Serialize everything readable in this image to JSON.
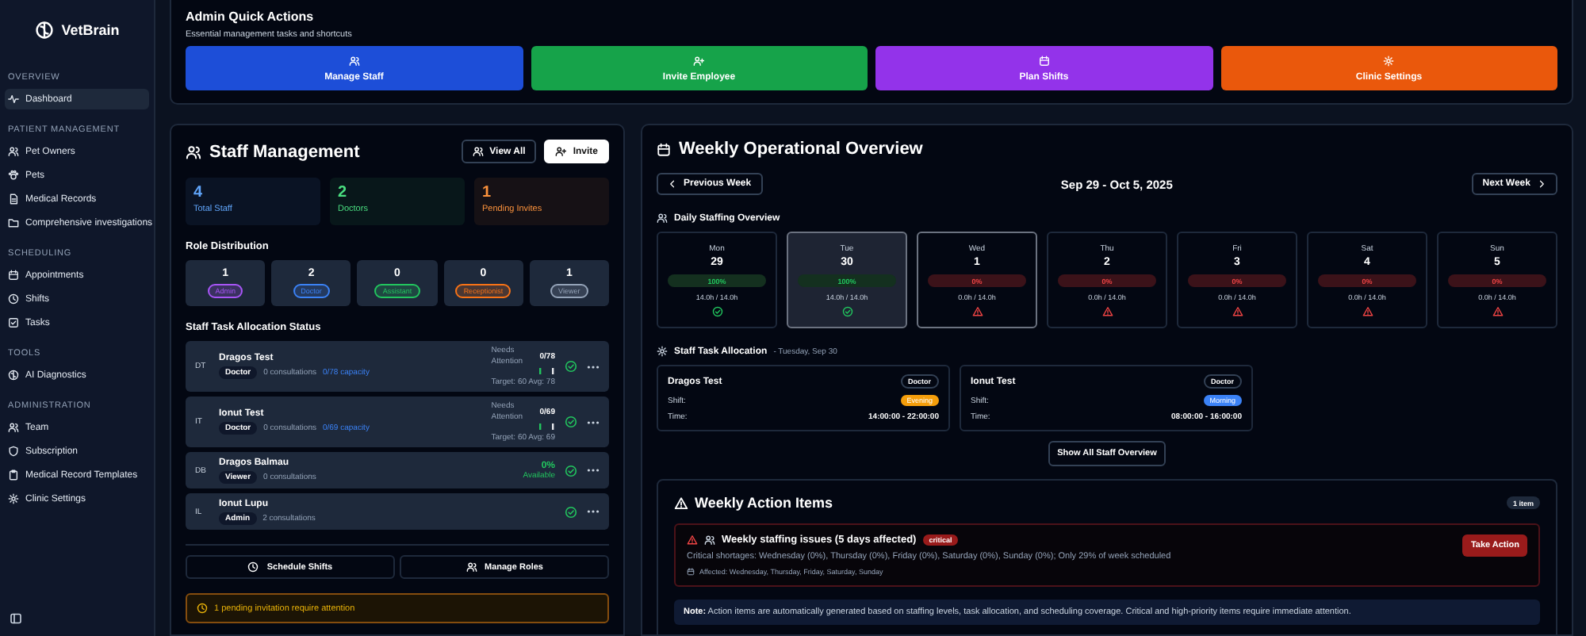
{
  "sidebar": {
    "brand": "VetBrain",
    "sections": [
      {
        "title": "OVERVIEW",
        "items": [
          {
            "label": "Dashboard",
            "selected": true
          }
        ]
      },
      {
        "title": "PATIENT MANAGEMENT",
        "items": [
          {
            "label": "Pet Owners",
            "selected": false
          },
          {
            "label": "Pets",
            "selected": false
          },
          {
            "label": "Medical Records",
            "selected": false
          },
          {
            "label": "Comprehensive investigations",
            "selected": false
          }
        ]
      },
      {
        "title": "SCHEDULING",
        "items": [
          {
            "label": "Appointments",
            "selected": false
          },
          {
            "label": "Shifts",
            "selected": false
          },
          {
            "label": "Tasks",
            "selected": false
          }
        ]
      },
      {
        "title": "TOOLS",
        "items": [
          {
            "label": "AI Diagnostics",
            "selected": false
          }
        ]
      },
      {
        "title": "ADMINISTRATION",
        "items": [
          {
            "label": "Team",
            "selected": false
          },
          {
            "label": "Subscription",
            "selected": false
          },
          {
            "label": "Medical Record Templates",
            "selected": false
          },
          {
            "label": "Clinic Settings",
            "selected": false
          }
        ]
      }
    ]
  },
  "quick_actions": {
    "title": "Admin Quick Actions",
    "subtitle": "Essential management tasks and shortcuts",
    "buttons": [
      {
        "label": "Manage Staff",
        "color": "#1d4ed8"
      },
      {
        "label": "Invite Employee",
        "color": "#16a34a"
      },
      {
        "label": "Plan Shifts",
        "color": "#9333ea"
      },
      {
        "label": "Clinic Settings",
        "color": "#ea580c"
      }
    ]
  },
  "staff_management": {
    "title": "Staff Management",
    "view_all": "View All",
    "invite": "Invite",
    "stats": [
      {
        "value": "4",
        "label": "Total Staff",
        "color": "#60a5fa"
      },
      {
        "value": "2",
        "label": "Doctors",
        "color": "#4ade80"
      },
      {
        "value": "1",
        "label": "Pending Invites",
        "color": "#fb923c"
      }
    ],
    "role_title": "Role Distribution",
    "roles": [
      {
        "count": "1",
        "label": "Admin",
        "color": "#a855f7"
      },
      {
        "count": "2",
        "label": "Doctor",
        "color": "#3b82f6"
      },
      {
        "count": "0",
        "label": "Assistant",
        "color": "#22c55e"
      },
      {
        "count": "0",
        "label": "Receptionist",
        "color": "#f97316"
      },
      {
        "count": "1",
        "label": "Viewer",
        "color": "#94a3b8"
      }
    ],
    "allocation_title": "Staff Task Allocation Status",
    "staff": [
      {
        "kind": "attention",
        "initials": "DT",
        "name": "Dragos Test",
        "role": "Doctor",
        "consultations": "0 consultations",
        "capacity": "0/78 capacity",
        "status": "Needs Attention",
        "ratio": "0/78",
        "target": "Target: 60 Avg: 78"
      },
      {
        "kind": "attention",
        "initials": "IT",
        "name": "Ionut Test",
        "role": "Doctor",
        "consultations": "0 consultations",
        "capacity": "0/69 capacity",
        "status": "Needs Attention",
        "ratio": "0/69",
        "target": "Target: 60 Avg: 69"
      },
      {
        "kind": "available",
        "initials": "DB",
        "name": "Dragos Balmau",
        "role": "Viewer",
        "consultations": "0 consultations",
        "percent": "0%",
        "status": "Available"
      },
      {
        "kind": "plain",
        "initials": "IL",
        "name": "Ionut Lupu",
        "role": "Admin",
        "consultations": "2 consultations"
      }
    ],
    "actions": [
      "Schedule Shifts",
      "Manage Roles"
    ],
    "warning": "1 pending invitation require attention"
  },
  "weekly": {
    "title": "Weekly Operational Overview",
    "prev": "Previous Week",
    "next": "Next Week",
    "range": "Sep 29 - Oct 5, 2025",
    "daily_title": "Daily Staffing Overview",
    "days": [
      {
        "day": "Mon",
        "date": "29",
        "percent": "100%",
        "hours": "14.0h / 14.0h",
        "kind": "ok",
        "selected": false,
        "today": false
      },
      {
        "day": "Tue",
        "date": "30",
        "percent": "100%",
        "hours": "14.0h / 14.0h",
        "kind": "ok",
        "selected": true,
        "today": false
      },
      {
        "day": "Wed",
        "date": "1",
        "percent": "0%",
        "hours": "0.0h / 14.0h",
        "kind": "short",
        "selected": false,
        "today": true
      },
      {
        "day": "Thu",
        "date": "2",
        "percent": "0%",
        "hours": "0.0h / 14.0h",
        "kind": "short",
        "selected": false,
        "today": false
      },
      {
        "day": "Fri",
        "date": "3",
        "percent": "0%",
        "hours": "0.0h / 14.0h",
        "kind": "short",
        "selected": false,
        "today": false
      },
      {
        "day": "Sat",
        "date": "4",
        "percent": "0%",
        "hours": "0.0h / 14.0h",
        "kind": "short",
        "selected": false,
        "today": false
      },
      {
        "day": "Sun",
        "date": "5",
        "percent": "0%",
        "hours": "0.0h / 14.0h",
        "kind": "short",
        "selected": false,
        "today": false
      }
    ],
    "allocation_title": "Staff Task Allocation",
    "allocation_date": "- Tuesday, Sep 30",
    "shifts": [
      {
        "name": "Dragos Test",
        "role": "Doctor",
        "shift_label": "Shift:",
        "shift": "Evening",
        "color": "#f59e0b",
        "time_label": "Time:",
        "time": "14:00:00 - 22:00:00"
      },
      {
        "name": "Ionut Test",
        "role": "Doctor",
        "shift_label": "Shift:",
        "shift": "Morning",
        "color": "#3b82f6",
        "time_label": "Time:",
        "time": "08:00:00 - 16:00:00"
      }
    ],
    "show_all": "Show All Staff Overview",
    "action_items": {
      "title": "Weekly Action Items",
      "count": "1 item",
      "items": [
        {
          "title": "Weekly staffing issues (5 days affected)",
          "badge": "critical",
          "description": "Critical shortages: Wednesday (0%), Thursday (0%), Friday (0%), Saturday (0%), Sunday (0%); Only 29% of week scheduled",
          "affected": "Affected: Wednesday, Thursday, Friday, Saturday, Sunday",
          "button": "Take Action"
        }
      ],
      "note": "**Note:** Action items are automatically generated based on staffing levels, task allocation, and scheduling coverage. Critical and high-priority items require immediate attention."
    }
  }
}
